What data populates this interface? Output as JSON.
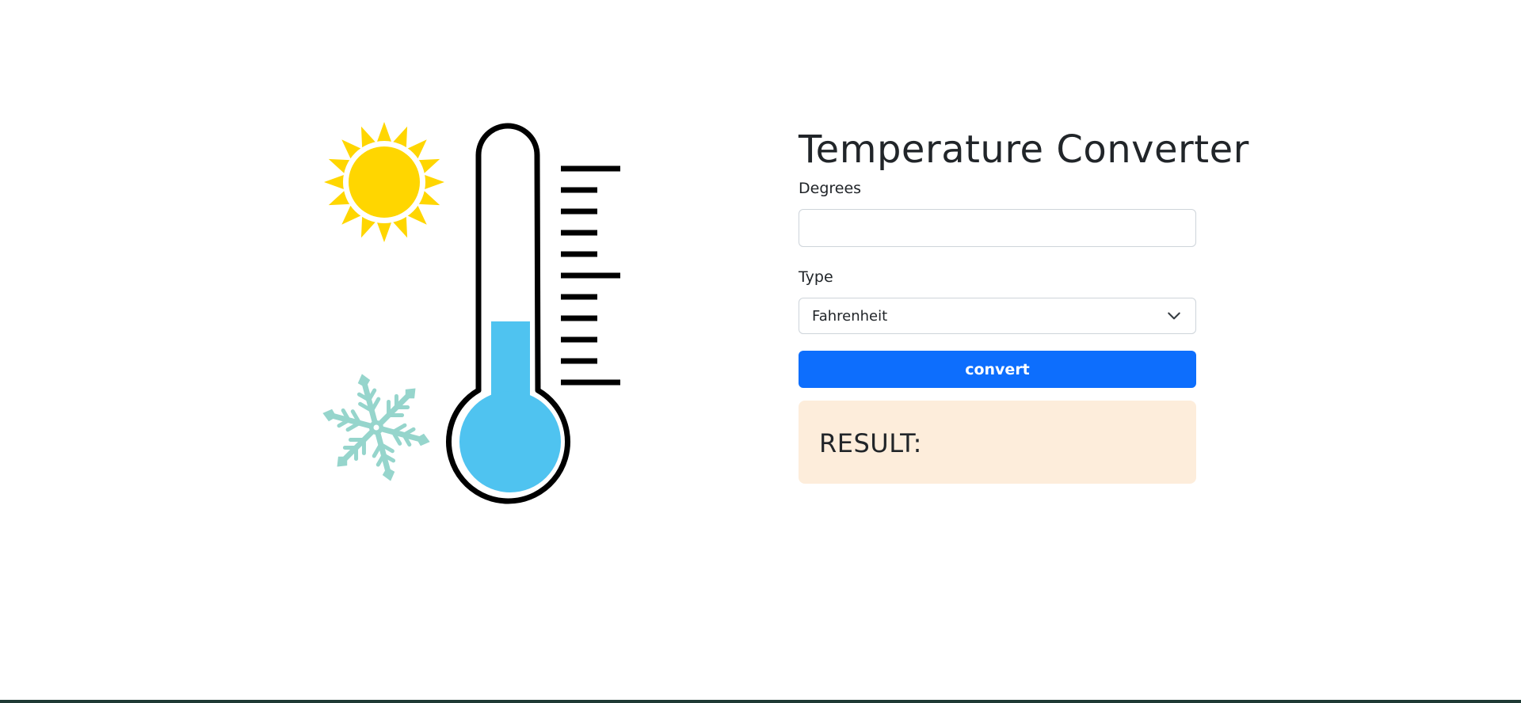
{
  "form": {
    "title": "Temperature Converter",
    "degrees_label": "Degrees",
    "degrees_value": "",
    "degrees_placeholder": "",
    "type_label": "Type",
    "type_selected": "Fahrenheit",
    "convert_label": "convert"
  },
  "result": {
    "label": "RESULT:"
  },
  "illustration": {
    "icons": [
      "sun-icon",
      "snowflake-icon",
      "thermometer-icon"
    ],
    "colors": {
      "sun": "#ffd600",
      "snowflake": "#96d5cc",
      "mercury": "#4fc3f0",
      "outline": "#000000"
    }
  },
  "colors": {
    "accent": "#0d6efd",
    "result_bg": "#fdeddb",
    "text": "#212529",
    "border": "#ced4da"
  }
}
